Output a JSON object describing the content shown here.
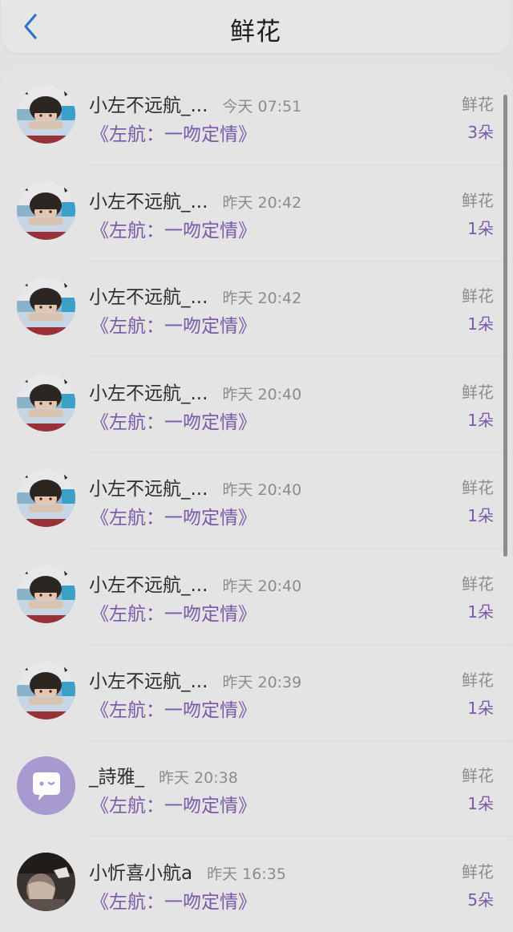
{
  "header": {
    "title": "鲜花",
    "back_icon": "chevron-left-icon",
    "accent": "#2f73c9"
  },
  "colors": {
    "book_title": "#7a5aa8",
    "count": "#7a5aa8",
    "username": "#2e2e2e",
    "muted": "#8c8c8c"
  },
  "items": [
    {
      "username": "小左不远航_...",
      "time": "今天 07:51",
      "book": "《左航：一吻定情》",
      "gift": "鲜花",
      "count": "3朵",
      "avatar": "boy-photo"
    },
    {
      "username": "小左不远航_...",
      "time": "昨天 20:42",
      "book": "《左航：一吻定情》",
      "gift": "鲜花",
      "count": "1朵",
      "avatar": "boy-photo"
    },
    {
      "username": "小左不远航_...",
      "time": "昨天 20:42",
      "book": "《左航：一吻定情》",
      "gift": "鲜花",
      "count": "1朵",
      "avatar": "boy-photo"
    },
    {
      "username": "小左不远航_...",
      "time": "昨天 20:40",
      "book": "《左航：一吻定情》",
      "gift": "鲜花",
      "count": "1朵",
      "avatar": "boy-photo"
    },
    {
      "username": "小左不远航_...",
      "time": "昨天 20:40",
      "book": "《左航：一吻定情》",
      "gift": "鲜花",
      "count": "1朵",
      "avatar": "boy-photo"
    },
    {
      "username": "小左不远航_...",
      "time": "昨天 20:40",
      "book": "《左航：一吻定情》",
      "gift": "鲜花",
      "count": "1朵",
      "avatar": "boy-photo"
    },
    {
      "username": "小左不远航_...",
      "time": "昨天 20:39",
      "book": "《左航：一吻定情》",
      "gift": "鲜花",
      "count": "1朵",
      "avatar": "boy-photo"
    },
    {
      "username": "_詩雅_",
      "time": "昨天 20:38",
      "book": "《左航：一吻定情》",
      "gift": "鲜花",
      "count": "1朵",
      "avatar": "default-chat-avatar"
    },
    {
      "username": "小忻喜小航a",
      "time": "昨天 16:35",
      "book": "《左航：一吻定情》",
      "gift": "鲜花",
      "count": "5朵",
      "avatar": "dark-photo"
    }
  ]
}
